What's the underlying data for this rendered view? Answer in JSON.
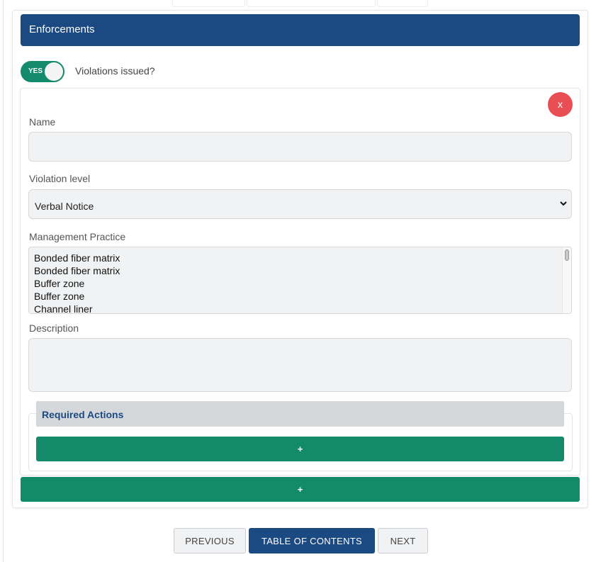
{
  "section": {
    "title": "Enforcements"
  },
  "toggle": {
    "state_label": "YES",
    "question": "Violations issued?"
  },
  "violation": {
    "close_label": "x",
    "name": {
      "label": "Name",
      "value": ""
    },
    "level": {
      "label": "Violation level",
      "selected": "Verbal Notice"
    },
    "practice": {
      "label": "Management Practice",
      "options": [
        "Bonded fiber matrix",
        "Bonded fiber matrix",
        "Buffer zone",
        "Buffer zone",
        "Channel liner"
      ]
    },
    "description": {
      "label": "Description",
      "value": ""
    },
    "required_actions": {
      "title": "Required Actions",
      "add_label": "+"
    }
  },
  "add_violation_label": "+",
  "nav": {
    "previous": "PREVIOUS",
    "toc": "TABLE OF CONTENTS",
    "next": "NEXT"
  },
  "colors": {
    "header": "#1b4a82",
    "green": "#138a6a",
    "close": "#e84e53"
  }
}
